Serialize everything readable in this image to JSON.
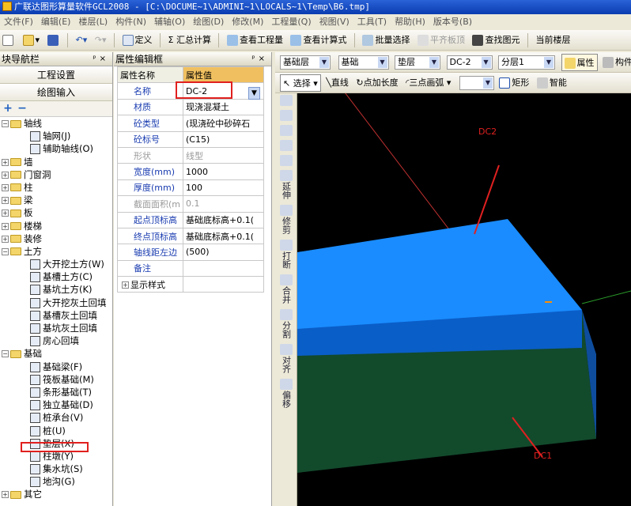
{
  "window": {
    "title": "广联达图形算量软件GCL2008 - [C:\\DOCUME~1\\ADMINI~1\\LOCALS~1\\Temp\\B6.tmp]"
  },
  "menu": [
    "文件(F)",
    "编辑(E)",
    "楼层(L)",
    "构件(N)",
    "辅轴(O)",
    "绘图(D)",
    "修改(M)",
    "工程量(Q)",
    "视图(V)",
    "工具(T)",
    "帮助(H)",
    "版本号(B)"
  ],
  "toolbar1": {
    "define": "定义",
    "sum": "Σ 汇总计算",
    "view_qty": "查看工程量",
    "view_formula": "查看计算式",
    "batch_select": "批量选择",
    "align_top": "平齐板顶",
    "find": "查找图元",
    "current_floor": "当前楼层"
  },
  "left_panel": {
    "title": "块导航栏",
    "btn_project": "工程设置",
    "btn_draw": "绘图输入",
    "tree": [
      {
        "label": "轴线",
        "expanded": true,
        "children": [
          "轴网(J)",
          "辅助轴线(O)"
        ]
      },
      {
        "label": "墙"
      },
      {
        "label": "门窗洞"
      },
      {
        "label": "柱"
      },
      {
        "label": "梁"
      },
      {
        "label": "板"
      },
      {
        "label": "楼梯"
      },
      {
        "label": "装修"
      },
      {
        "label": "土方",
        "expanded": true,
        "children": [
          "大开挖土方(W)",
          "基槽土方(C)",
          "基坑土方(K)",
          "大开挖灰土回填",
          "基槽灰土回填",
          "基坑灰土回填",
          "房心回填"
        ]
      },
      {
        "label": "基础",
        "expanded": true,
        "children": [
          "基础梁(F)",
          "筏板基础(M)",
          "条形基础(T)",
          "独立基础(D)",
          "桩承台(V)",
          "桩(U)",
          "垫层(X)",
          "柱墩(Y)",
          "集水坑(S)",
          "地沟(G)"
        ]
      },
      {
        "label": "其它"
      }
    ]
  },
  "prop_panel": {
    "title": "属性编辑框",
    "col_name": "属性名称",
    "col_value": "属性值",
    "rows": [
      {
        "k": "名称",
        "v": "DC-2"
      },
      {
        "k": "材质",
        "v": "现浇混凝土"
      },
      {
        "k": "砼类型",
        "v": "(现浇砼中砂碎石"
      },
      {
        "k": "砼标号",
        "v": "(C15)"
      },
      {
        "k": "形状",
        "v": "线型"
      },
      {
        "k": "宽度(mm)",
        "v": "1000"
      },
      {
        "k": "厚度(mm)",
        "v": "100"
      },
      {
        "k": "截面面积(m",
        "v": "0.1"
      },
      {
        "k": "起点顶标高",
        "v": "基础底标高+0.1("
      },
      {
        "k": "终点顶标高",
        "v": "基础底标高+0.1("
      },
      {
        "k": "轴线距左边",
        "v": "(500)"
      },
      {
        "k": "备注",
        "v": ""
      },
      {
        "k": "显示样式",
        "v": ""
      }
    ]
  },
  "toolbar2": {
    "floor": "基础层",
    "type": "基础",
    "sub": "垫层",
    "item": "DC-2",
    "layer": "分层1",
    "attr": "属性",
    "struct": "构件"
  },
  "toolbar3": {
    "select": "选择",
    "line": "直线",
    "point_len": "点加长度",
    "arc3": "三点画弧",
    "rect": "矩形",
    "smart": "智能"
  },
  "vtools": [
    "延伸",
    "修剪",
    "打断",
    "合并",
    "分割",
    "对齐",
    "偏移"
  ],
  "viewport": {
    "label_dc2": "DC2",
    "label_dc1": "DC1",
    "colors": {
      "top": "#1a8cff",
      "front_upper": "#0a5ec8",
      "front_lower": "#124a2c",
      "side": "#0e4d9e"
    }
  }
}
